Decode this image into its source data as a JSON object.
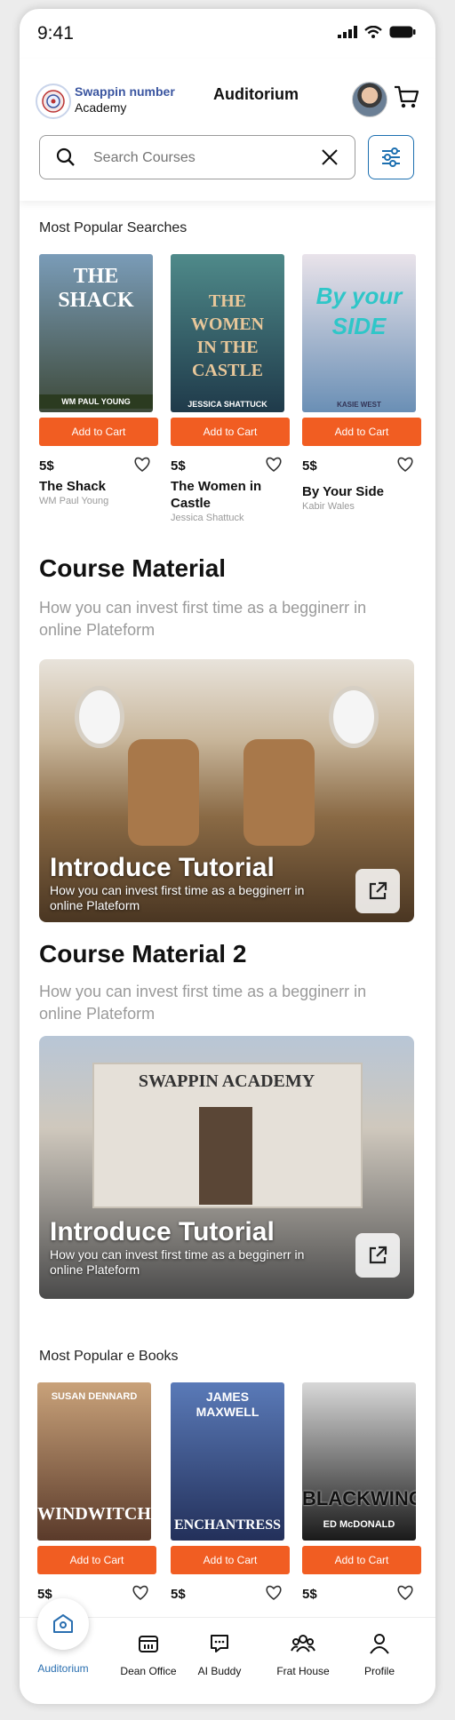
{
  "status": {
    "time": "9:41"
  },
  "header": {
    "brand_line1": "Swappin number",
    "brand_line2": "Academy",
    "title": "Auditorium",
    "search_placeholder": "Search Courses"
  },
  "popular_searches": {
    "label": "Most Popular Searches",
    "books": [
      {
        "cover_title": "THE SHACK",
        "cover_author": "WM PAUL YOUNG",
        "button": "Add to Cart",
        "price": "5$",
        "title": "The Shack",
        "author": "WM Paul Young",
        "colors": [
          "#7a9cb8",
          "#3e4a3a"
        ]
      },
      {
        "cover_title": "THE WOMEN IN THE CASTLE",
        "cover_author": "JESSICA SHATTUCK",
        "button": "Add to Cart",
        "price": "5$",
        "title": "The Women in Castle",
        "author": "Jessica Shattuck",
        "colors": [
          "#4f8a8a",
          "#1f3a4a"
        ]
      },
      {
        "cover_title": "By your SIDE",
        "cover_author": "KASIE WEST",
        "button": "Add to Cart",
        "price": "5$",
        "title": "By Your Side",
        "author": "Kabir Wales",
        "colors": [
          "#e9e3ea",
          "#6a8fb5"
        ]
      }
    ]
  },
  "course1": {
    "heading": "Course Material",
    "subtitle": "How you can invest first time as a begginerr in online Plateform",
    "card_title": "Introduce Tutorial",
    "card_desc": "How you can invest first time as a begginerr in online Plateform"
  },
  "course2": {
    "heading": "Course Material 2",
    "subtitle": "How you can invest first time as a begginerr in online Plateform",
    "card_title": "Introduce Tutorial",
    "card_desc": "How you can invest first time as a begginerr in online Plateform",
    "card_sign": "SWAPPIN ACADEMY"
  },
  "ebooks": {
    "label": "Most Popular e Books",
    "books": [
      {
        "cover_title": "WINDWITCH",
        "cover_author": "SUSAN DENNARD",
        "button": "Add to Cart",
        "price": "5$",
        "colors": [
          "#c9a27a",
          "#5a3a2a"
        ]
      },
      {
        "cover_title": "ENCHANTRESS",
        "cover_author": "JAMES MAXWELL",
        "button": "Add to Cart",
        "price": "5$",
        "colors": [
          "#5a7ab8",
          "#23305a"
        ]
      },
      {
        "cover_title": "BLACKWING",
        "cover_author": "ED McDONALD",
        "button": "Add to Cart",
        "price": "5$",
        "colors": [
          "#d8d8d8",
          "#1a1a1a"
        ]
      }
    ]
  },
  "nav": {
    "items": [
      {
        "label": "Auditorium",
        "icon": "home-icon",
        "active": true
      },
      {
        "label": "Dean Office",
        "icon": "office-icon"
      },
      {
        "label": "AI Buddy",
        "icon": "chat-icon"
      },
      {
        "label": "Frat House",
        "icon": "group-icon"
      },
      {
        "label": "Profile",
        "icon": "user-icon"
      }
    ]
  },
  "colors": {
    "accent": "#f15d22",
    "brand_blue": "#3a55a0",
    "filter_blue": "#1c6fb0"
  }
}
